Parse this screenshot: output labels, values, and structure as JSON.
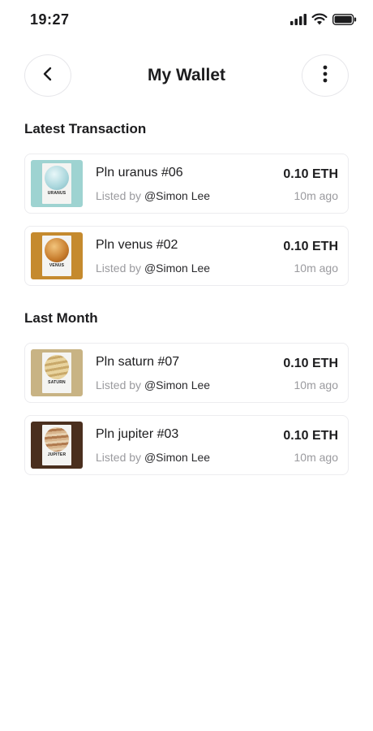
{
  "status": {
    "time": "19:27"
  },
  "header": {
    "title": "My Wallet",
    "back_icon": "chevron-left-icon",
    "more_icon": "more-vertical-icon"
  },
  "sections": [
    {
      "title": "Latest Transaction",
      "items": [
        {
          "name": "Pln uranus #06",
          "listed_prefix": "Listed by",
          "user": "@Simon Lee",
          "price": "0.10 ETH",
          "time": "10m ago",
          "thumb_label": "URANUS",
          "thumb_bg": "#9ed3d1",
          "planet_color": "#bfe3e8"
        },
        {
          "name": "Pln venus #02",
          "listed_prefix": "Listed by",
          "user": "@Simon Lee",
          "price": "0.10 ETH",
          "time": "10m ago",
          "thumb_label": "VENUS",
          "thumb_bg": "#c58a2e",
          "planet_color": "#d99a4a"
        }
      ]
    },
    {
      "title": "Last Month",
      "items": [
        {
          "name": "Pln saturn #07",
          "listed_prefix": "Listed by",
          "user": "@Simon Lee",
          "price": "0.10 ETH",
          "time": "10m ago",
          "thumb_label": "SATURN",
          "thumb_bg": "#c8b384",
          "planet_color": "#d8c28a"
        },
        {
          "name": "Pln jupiter #03",
          "listed_prefix": "Listed by",
          "user": "@Simon Lee",
          "price": "0.10 ETH",
          "time": "10m ago",
          "thumb_label": "JUPITER",
          "thumb_bg": "#4a2f1e",
          "planet_color": "#c9a27a"
        }
      ]
    }
  ]
}
